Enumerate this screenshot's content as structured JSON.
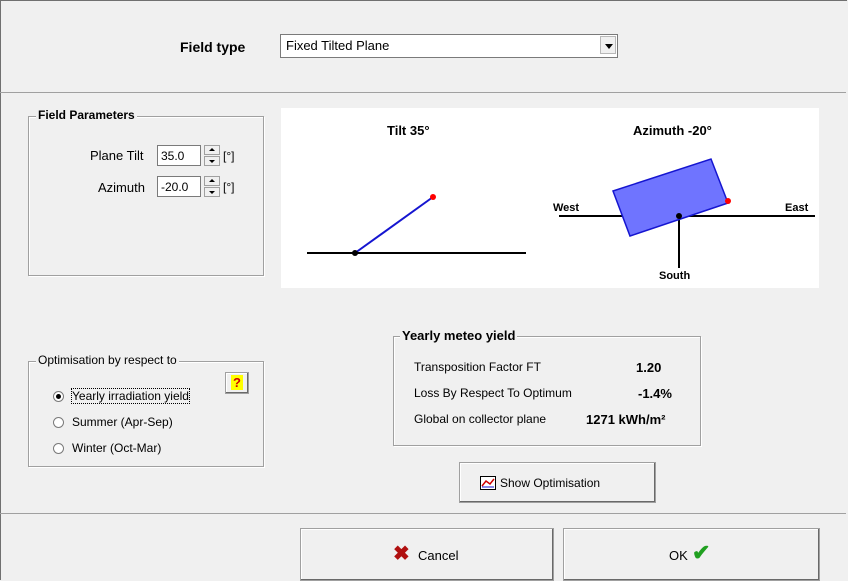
{
  "header": {
    "field_type_label": "Field type",
    "field_type_value": "Fixed Tilted Plane"
  },
  "field_parameters": {
    "title": "Field Parameters",
    "plane_tilt_label": "Plane Tilt",
    "plane_tilt_value": "35.0",
    "plane_tilt_unit": "[°]",
    "azimuth_label": "Azimuth",
    "azimuth_value": "-20.0",
    "azimuth_unit": "[°]"
  },
  "diagram": {
    "tilt_title": "Tilt 35°",
    "azimuth_title": "Azimuth -20°",
    "west": "West",
    "east": "East",
    "south": "South",
    "plane_color": "#6f74ff",
    "line_color": "#1515d0",
    "marker_color": "#ff0000"
  },
  "optimisation": {
    "title": "Optimisation by respect to",
    "options": [
      "Yearly irradiation yield",
      "Summer (Apr-Sep)",
      "Winter (Oct-Mar)"
    ],
    "selected": "Yearly irradiation yield",
    "help_label": "?"
  },
  "meteo": {
    "title": "Yearly meteo yield",
    "rows": [
      {
        "label": "Transposition Factor FT",
        "value": "1.20"
      },
      {
        "label": "Loss By Respect To Optimum",
        "value": "-1.4%"
      },
      {
        "label": "Global on collector plane",
        "value": "1271 kWh/m²"
      }
    ]
  },
  "buttons": {
    "show_optimisation": "Show Optimisation",
    "cancel": "Cancel",
    "ok": "OK"
  }
}
